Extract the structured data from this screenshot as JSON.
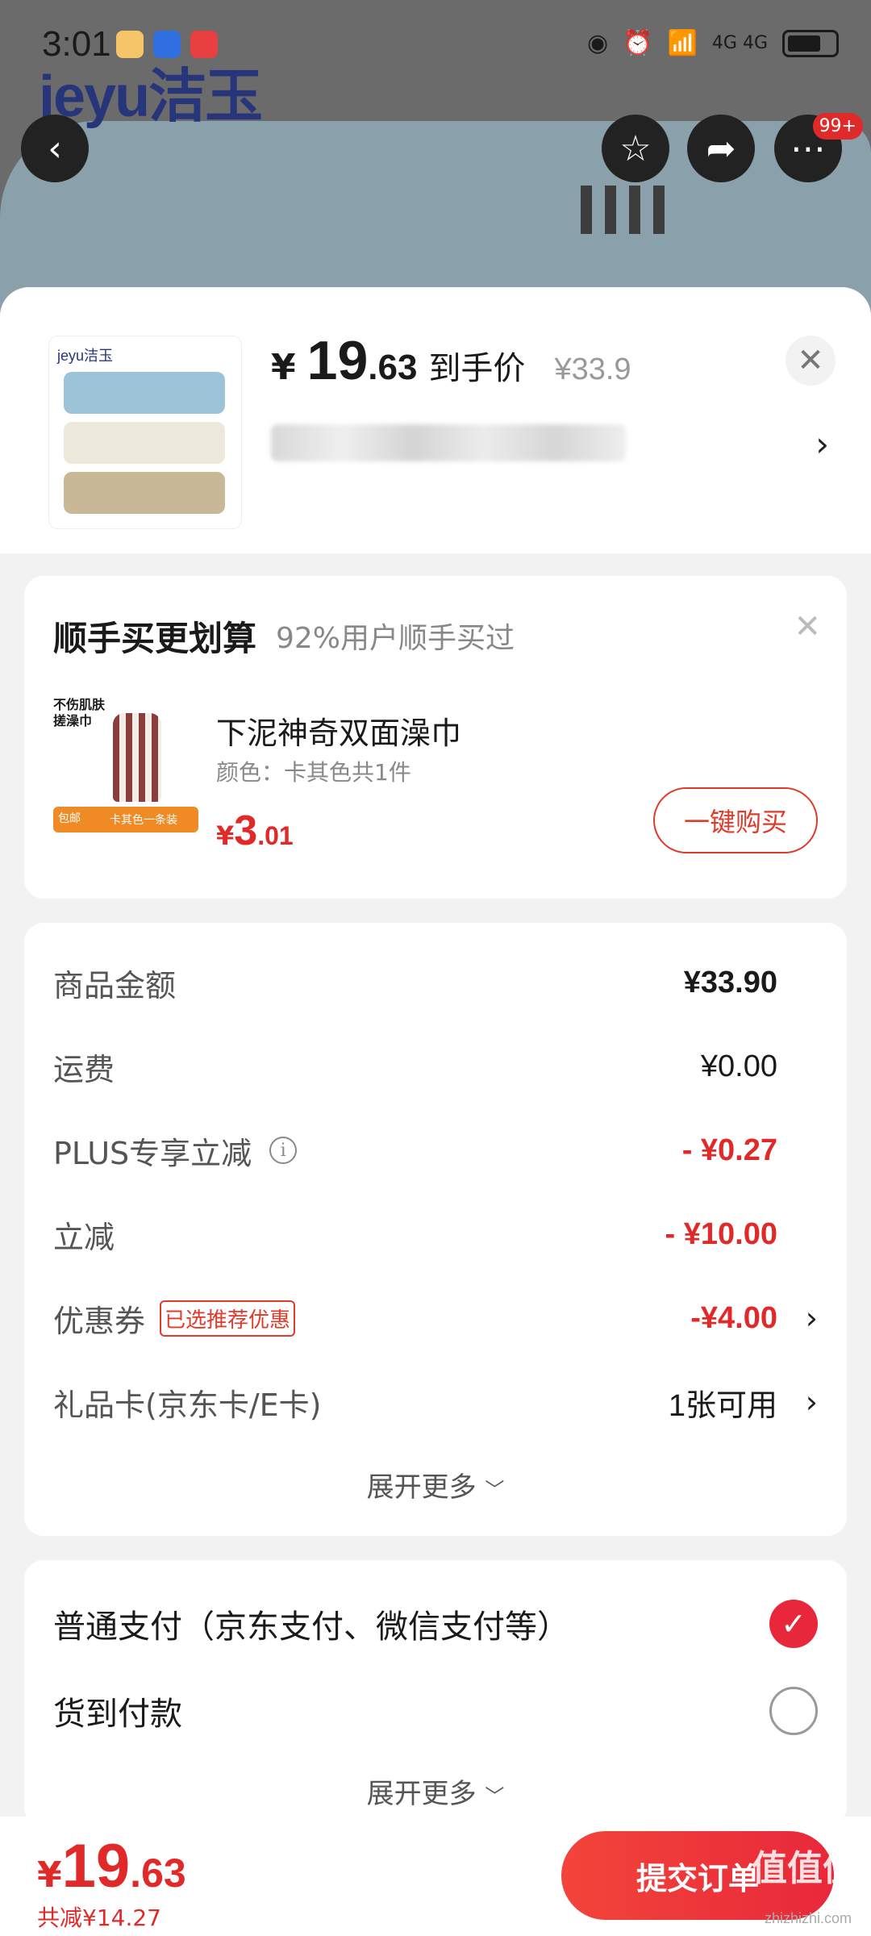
{
  "status_bar": {
    "time": "3:01",
    "network": "4G 4G"
  },
  "brand": {
    "logo_text": "jeyu洁玉"
  },
  "nav": {
    "back": "‹",
    "more_badge": "99+"
  },
  "product": {
    "currency": "¥",
    "price_int": "19",
    "price_dec": ".63",
    "price_label": "到手价",
    "original_price": "¥33.9",
    "thumb_logo": "jeyu洁玉"
  },
  "addon": {
    "title": "顺手买更划算",
    "subtitle": "92%用户顺手买过",
    "item_name": "下泥神奇双面澡巾",
    "item_spec": "颜色：卡其色共1件",
    "currency": "¥",
    "price_int": "3",
    "price_dec": ".01",
    "buy_label": "一键购买",
    "img_caption": "不伤肌肤 搓澡巾",
    "img_tag": "卡其色一条装",
    "img_badge": "包邮"
  },
  "price_detail": {
    "rows": [
      {
        "label": "商品金额",
        "value": "¥33.90"
      },
      {
        "label": "运费",
        "value": "¥0.00"
      },
      {
        "label": "PLUS专享立减",
        "value": "- ¥0.27"
      },
      {
        "label": "立减",
        "value": "- ¥10.00"
      },
      {
        "label": "优惠券",
        "value": "-¥4.00",
        "tag": "已选推荐优惠"
      },
      {
        "label": "礼品卡(京东卡/E卡)",
        "value": "1张可用"
      }
    ],
    "expand_label": "展开更多"
  },
  "payment": {
    "options": [
      {
        "label": "普通支付（京东支付、微信支付等）",
        "selected": true
      },
      {
        "label": "货到付款",
        "selected": false
      }
    ],
    "expand_label": "展开更多"
  },
  "bottom": {
    "currency": "¥",
    "total_int": "19",
    "total_dec": ".63",
    "saved": "共减¥14.27",
    "submit_label": "提交订单",
    "watermark": "值值值",
    "watermark_url": "zhizhizhi.com"
  },
  "colors": {
    "accent": "#e8283a",
    "price_red": "#e02a2a"
  }
}
